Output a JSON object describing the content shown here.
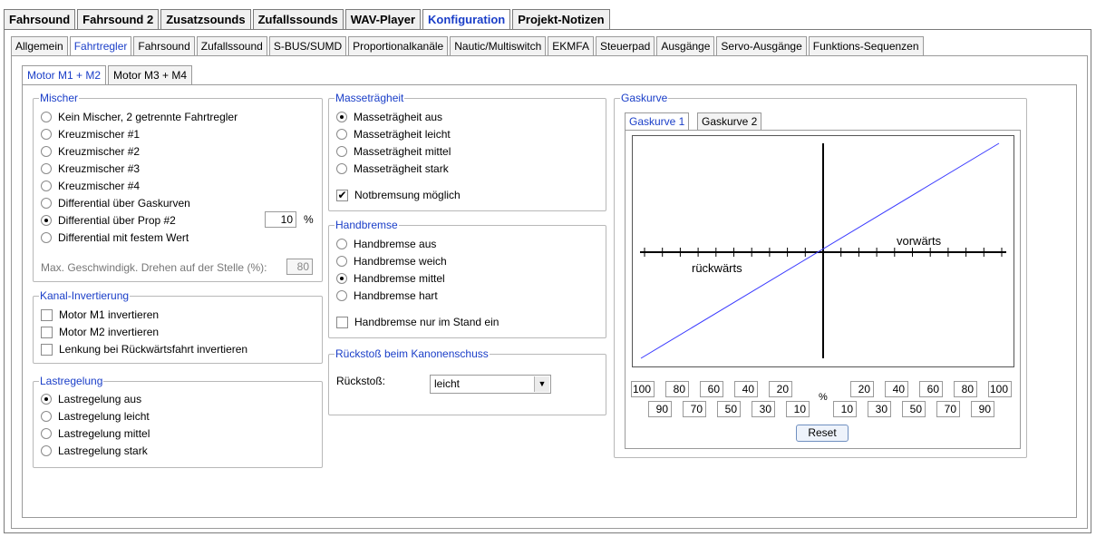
{
  "top_tabs": [
    "Fahrsound",
    "Fahrsound 2",
    "Zusatzsounds",
    "Zufallssounds",
    "WAV-Player",
    "Konfiguration",
    "Projekt-Notizen"
  ],
  "sub_tabs": [
    "Allgemein",
    "Fahrtregler",
    "Fahrsound",
    "Zufallssound",
    "S-BUS/SUMD",
    "Proportionalkanäle",
    "Nautic/Multiswitch",
    "EKMFA",
    "Steuerpad",
    "Ausgänge",
    "Servo-Ausgänge",
    "Funktions-Sequenzen"
  ],
  "motor_tabs": [
    "Motor M1 + M2",
    "Motor M3 + M4"
  ],
  "mischer": {
    "title": "Mischer",
    "options": [
      "Kein Mischer, 2 getrennte Fahrtregler",
      "Kreuzmischer #1",
      "Kreuzmischer #2",
      "Kreuzmischer #3",
      "Kreuzmischer #4",
      "Differential über Gaskurven",
      "Differential über Prop #2",
      "Differential mit festem Wert"
    ],
    "selected_index": 6,
    "prop_value": "10",
    "prop_unit": "%",
    "max_label": "Max. Geschwindigk. Drehen auf der Stelle (%):",
    "max_value": "80"
  },
  "kanal": {
    "title": "Kanal-Invertierung",
    "options": [
      "Motor M1 invertieren",
      "Motor M2 invertieren",
      "Lenkung bei Rückwärtsfahrt invertieren"
    ]
  },
  "last": {
    "title": "Lastregelung",
    "options": [
      "Lastregelung aus",
      "Lastregelung leicht",
      "Lastregelung mittel",
      "Lastregelung stark"
    ],
    "selected_index": 0
  },
  "masse": {
    "title": "Masseträgheit",
    "options": [
      "Masseträgheit aus",
      "Masseträgheit leicht",
      "Masseträgheit mittel",
      "Masseträgheit stark"
    ],
    "selected_index": 0,
    "notbremse": "Notbremsung möglich"
  },
  "hand": {
    "title": "Handbremse",
    "options": [
      "Handbremse aus",
      "Handbremse weich",
      "Handbremse mittel",
      "Handbremse hart"
    ],
    "selected_index": 2,
    "stand": "Handbremse nur im Stand ein"
  },
  "rueck": {
    "title": "Rückstoß beim Kanonenschuss",
    "label": "Rückstoß:",
    "value": "leicht"
  },
  "gas": {
    "title": "Gaskurve",
    "tabs": [
      "Gaskurve 1",
      "Gaskurve 2"
    ],
    "label_forward": "vorwärts",
    "label_backward": "rückwärts",
    "row1_left": [
      "100",
      "80",
      "60",
      "40",
      "20"
    ],
    "row1_right": [
      "20",
      "40",
      "60",
      "80",
      "100"
    ],
    "row2_left": [
      "90",
      "70",
      "50",
      "30",
      "10"
    ],
    "row2_right": [
      "10",
      "30",
      "50",
      "70",
      "90"
    ],
    "percent": "%",
    "reset": "Reset",
    "line_color": "#3a3aff"
  }
}
